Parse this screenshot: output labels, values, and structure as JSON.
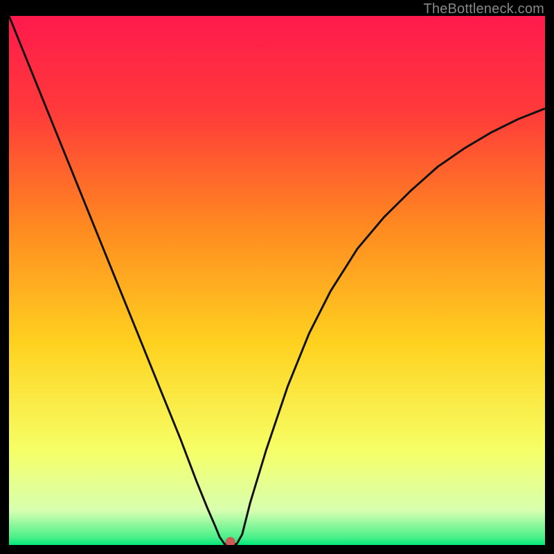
{
  "watermark": "TheBottleneck.com",
  "colors": {
    "top": "#ff1a4d",
    "mid_upper": "#ff6a2a",
    "mid": "#ffd21f",
    "mid_lower": "#f6ff66",
    "bottom": "#00e77a",
    "curve": "#111111",
    "marker": "#cc5a55",
    "frame": "#000000"
  },
  "chart_data": {
    "type": "line",
    "title": "",
    "xlabel": "",
    "ylabel": "",
    "xlim": [
      0,
      100
    ],
    "ylim": [
      0,
      100
    ],
    "series": [
      {
        "name": "bottleneck-curve",
        "x": [
          0,
          4,
          8,
          12,
          16,
          20,
          24,
          28,
          32,
          35,
          37,
          38.5,
          39.3,
          40.0,
          40.2,
          42.5,
          43.5,
          45,
          48,
          52,
          56,
          60,
          65,
          70,
          75,
          80,
          85,
          90,
          95,
          100
        ],
        "y": [
          100,
          90,
          80,
          70,
          60,
          50,
          40,
          30,
          20,
          12,
          7,
          3.5,
          1.5,
          0.5,
          0.2,
          0.2,
          2,
          8,
          18,
          30,
          40,
          48,
          56,
          62,
          67,
          71.5,
          75,
          78,
          80.5,
          82.5
        ]
      }
    ],
    "marker": {
      "x": 41.3,
      "y": 0.6
    },
    "gradient_stops": [
      {
        "pos": 0.0,
        "color": "#ff1a4d"
      },
      {
        "pos": 0.18,
        "color": "#ff3a3a"
      },
      {
        "pos": 0.4,
        "color": "#ff8a20"
      },
      {
        "pos": 0.62,
        "color": "#ffd21f"
      },
      {
        "pos": 0.82,
        "color": "#f6ff66"
      },
      {
        "pos": 0.935,
        "color": "#d8ffb0"
      },
      {
        "pos": 0.985,
        "color": "#4cf08a"
      },
      {
        "pos": 1.0,
        "color": "#00e77a"
      }
    ]
  }
}
